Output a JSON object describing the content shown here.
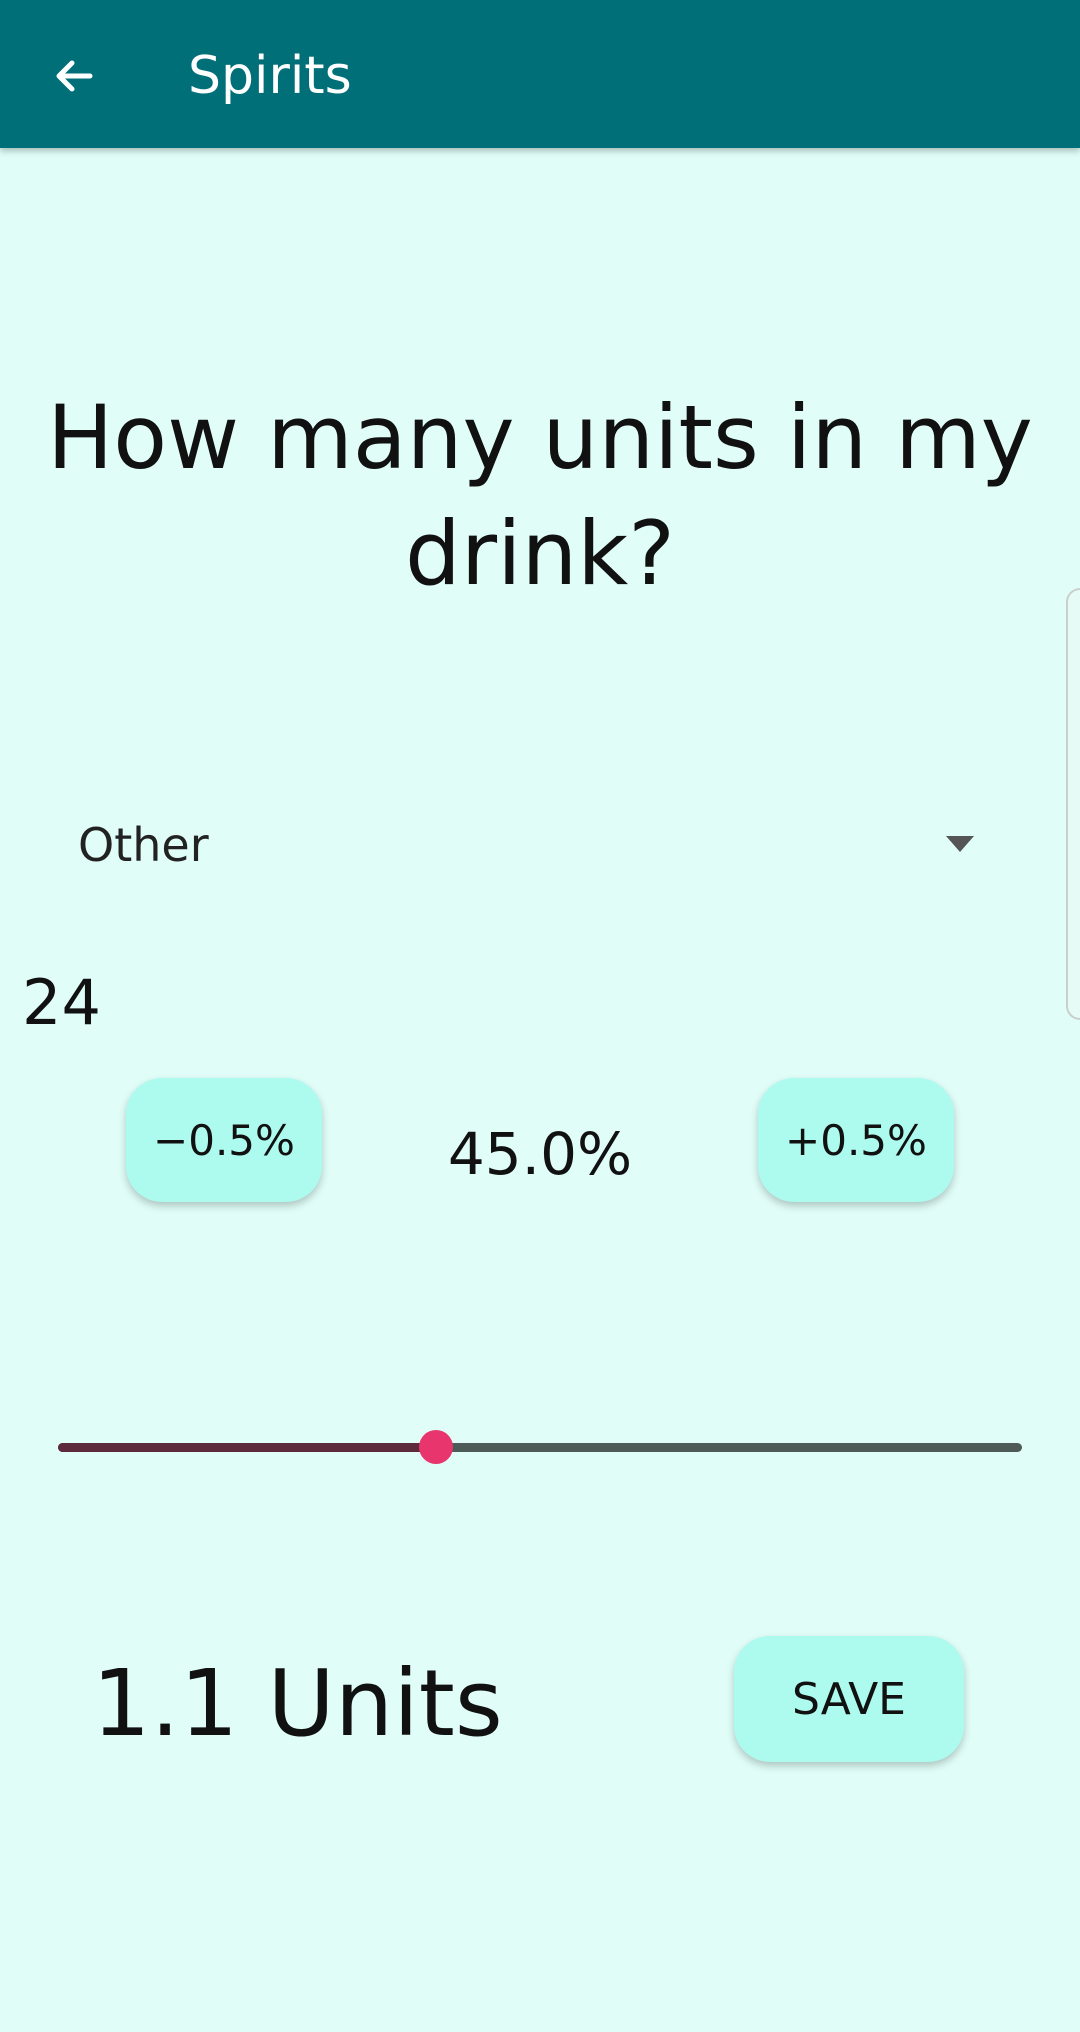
{
  "app_bar": {
    "title": "Spirits",
    "back_icon": "arrow-back-icon",
    "background_color": "#006f78"
  },
  "heading": "How many units in my drink?",
  "drink_select": {
    "selected": "Other",
    "icon": "dropdown-arrow-icon"
  },
  "count_value": "24",
  "abv": {
    "decrease_label": "−0.5%",
    "value_label": "45.0%",
    "increase_label": "+0.5%"
  },
  "slider": {
    "fraction": 0.392,
    "thumb_color": "#e8356d"
  },
  "result": {
    "units_label": "1.1 Units",
    "save_label": "SAVE"
  },
  "accent_color": "#adfaee",
  "background_color": "#e0fdf8"
}
